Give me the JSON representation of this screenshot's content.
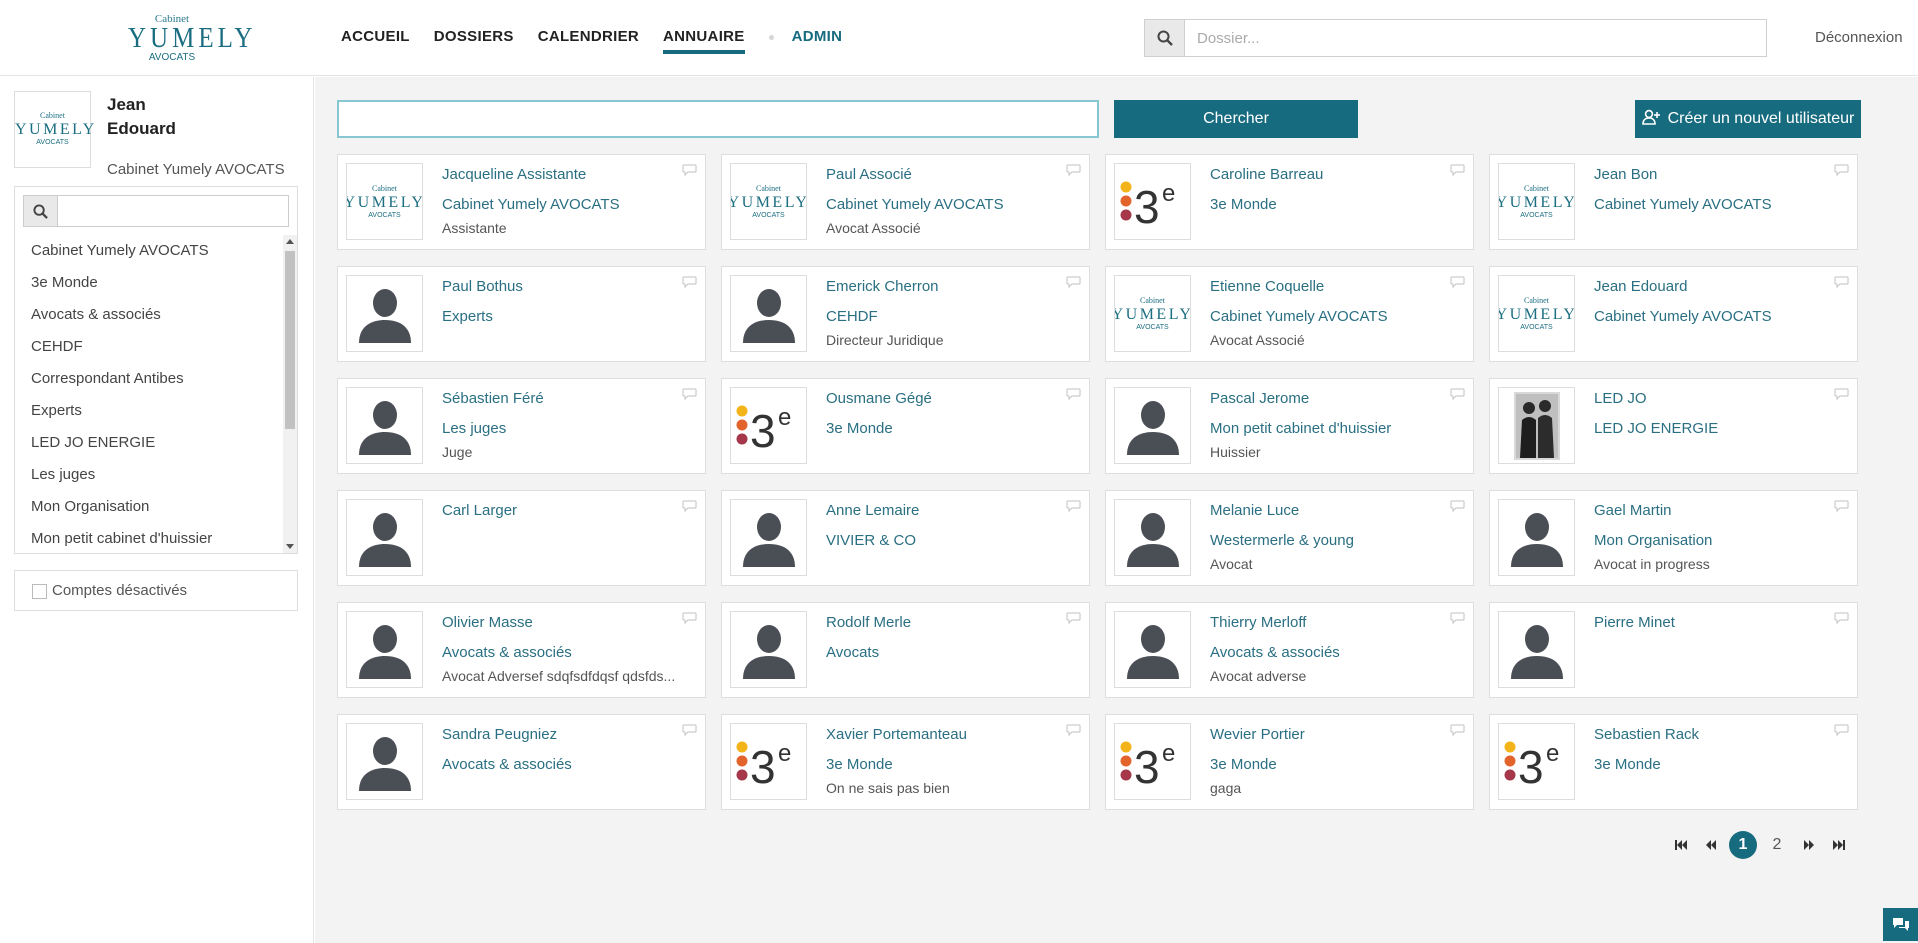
{
  "brand": {
    "line1": "Cabinet",
    "line2": "YUMELY",
    "line3": "AVOCATS"
  },
  "nav": {
    "items": [
      "ACCUEIL",
      "DOSSIERS",
      "CALENDRIER",
      "ANNUAIRE"
    ],
    "admin": "ADMIN",
    "active": "ANNUAIRE"
  },
  "top_search": {
    "placeholder": "Dossier...",
    "value": ""
  },
  "logout": "Déconnexion",
  "profile": {
    "first": "Jean",
    "last": "Edouard",
    "org": "Cabinet Yumely AVOCATS"
  },
  "org_search": {
    "value": ""
  },
  "orgs": [
    "Cabinet Yumely AVOCATS",
    "3e Monde",
    "Avocats & associés",
    "CEHDF",
    "Correspondant Antibes",
    "Experts",
    "LED JO ENERGIE",
    "Les juges",
    "Mon Organisation",
    "Mon petit cabinet d'huissier"
  ],
  "disabled_accounts": "Comptes désactivés",
  "main_search": {
    "value": ""
  },
  "search_button": "Chercher",
  "create_button": "Créer un nouvel utilisateur",
  "users": [
    {
      "name": "Jacqueline Assistante",
      "org": "Cabinet Yumely AVOCATS",
      "role": "Assistante",
      "avatar": "yumely"
    },
    {
      "name": "Paul Associé",
      "org": "Cabinet Yumely AVOCATS",
      "role": "Avocat Associé",
      "avatar": "yumely"
    },
    {
      "name": "Caroline Barreau",
      "org": "3e Monde",
      "role": "",
      "avatar": "3e"
    },
    {
      "name": "Jean Bon",
      "org": "Cabinet Yumely AVOCATS",
      "role": "",
      "avatar": "yumely"
    },
    {
      "name": "Paul Bothus",
      "org": "Experts",
      "role": "",
      "avatar": "person"
    },
    {
      "name": "Emerick Cherron",
      "org": "CEHDF",
      "role": "Directeur Juridique",
      "avatar": "person"
    },
    {
      "name": "Etienne Coquelle",
      "org": "Cabinet Yumely AVOCATS",
      "role": "Avocat Associé",
      "avatar": "yumely"
    },
    {
      "name": "Jean Edouard",
      "org": "Cabinet Yumely AVOCATS",
      "role": "",
      "avatar": "yumely"
    },
    {
      "name": "Sébastien Féré",
      "org": "Les juges",
      "role": "Juge",
      "avatar": "person"
    },
    {
      "name": "Ousmane Gégé",
      "org": "3e Monde",
      "role": "",
      "avatar": "3e"
    },
    {
      "name": "Pascal Jerome",
      "org": "Mon petit cabinet d'huissier",
      "role": "Huissier",
      "avatar": "person"
    },
    {
      "name": "LED JO",
      "org": "LED JO ENERGIE",
      "role": "",
      "avatar": "photo"
    },
    {
      "name": "Carl Larger",
      "org": "",
      "role": "",
      "avatar": "person"
    },
    {
      "name": "Anne Lemaire",
      "org": "VIVIER & CO",
      "role": "",
      "avatar": "person"
    },
    {
      "name": "Melanie Luce",
      "org": "Westermerle & young",
      "role": "Avocat",
      "avatar": "person"
    },
    {
      "name": "Gael Martin",
      "org": "Mon Organisation",
      "role": "Avocat in progress",
      "avatar": "person"
    },
    {
      "name": "Olivier Masse",
      "org": "Avocats & associés",
      "role": "Avocat Adversef sdqfsdfdqsf qdsfds...",
      "avatar": "person"
    },
    {
      "name": "Rodolf Merle",
      "org": "Avocats",
      "role": "",
      "avatar": "person"
    },
    {
      "name": "Thierry Merloff",
      "org": "Avocats & associés",
      "role": "Avocat adverse",
      "avatar": "person"
    },
    {
      "name": "Pierre Minet",
      "org": "",
      "role": "",
      "avatar": "person"
    },
    {
      "name": "Sandra Peugniez",
      "org": "Avocats & associés",
      "role": "",
      "avatar": "person"
    },
    {
      "name": "Xavier Portemanteau",
      "org": "3e Monde",
      "role": "On ne sais pas bien",
      "avatar": "3e"
    },
    {
      "name": "Wevier Portier",
      "org": "3e Monde",
      "role": "gaga",
      "avatar": "3e"
    },
    {
      "name": "Sebastien Rack",
      "org": "3e Monde",
      "role": "",
      "avatar": "3e"
    }
  ],
  "pagination": {
    "pages": [
      "1",
      "2"
    ],
    "current": "1"
  },
  "colors": {
    "accent": "#176b7f",
    "link": "#2a6f82"
  }
}
